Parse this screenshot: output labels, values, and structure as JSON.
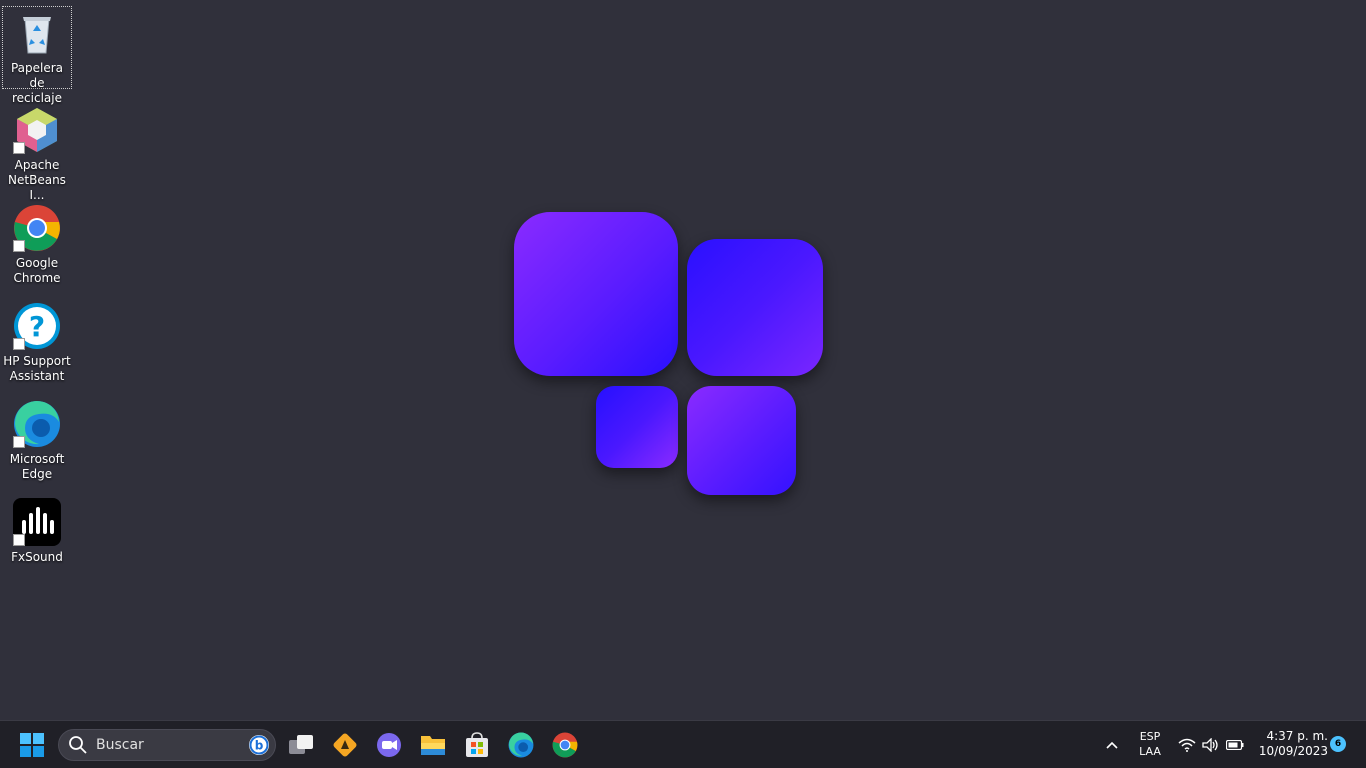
{
  "desktop": {
    "icons": [
      {
        "label": "Papelera de\nreciclaje",
        "icon": "recycle-bin-icon"
      },
      {
        "label": "Apache\nNetBeans I...",
        "icon": "netbeans-icon"
      },
      {
        "label": "Google\nChrome",
        "icon": "chrome-icon"
      },
      {
        "label": "HP Support\nAssistant",
        "icon": "hp-support-icon"
      },
      {
        "label": "Microsoft\nEdge",
        "icon": "edge-icon"
      },
      {
        "label": "FxSound",
        "icon": "fxsound-icon"
      }
    ],
    "wallpaper_colors": {
      "violet": "#8a2bff",
      "blue": "#2a10ff"
    }
  },
  "taskbar": {
    "search_placeholder": "Buscar",
    "pinned": [
      "task-view-icon",
      "app-orange-icon",
      "teams-chat-icon",
      "file-explorer-icon",
      "microsoft-store-icon",
      "edge-icon",
      "chrome-icon"
    ],
    "tray": {
      "language": "ESP",
      "layout": "LAA",
      "time": "4:37 p. m.",
      "date": "10/09/2023",
      "notifications": "6"
    }
  }
}
